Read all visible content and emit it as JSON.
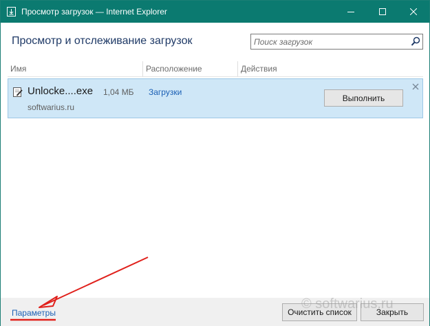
{
  "window": {
    "title": "Просмотр загрузок — Internet Explorer",
    "accent_color": "#0b7a70",
    "controls": [
      "minimize-icon",
      "maximize-icon",
      "close-icon"
    ]
  },
  "header": {
    "title": "Просмотр и отслеживание загрузок",
    "search_placeholder": "Поиск загрузок",
    "search_icon": "search-icon"
  },
  "table": {
    "columns": [
      "Имя",
      "Расположение",
      "Действия"
    ],
    "rows": [
      {
        "icon": "file-icon",
        "name": "Unlocke....exe",
        "size": "1,04 МБ",
        "source": "softwarius.ru",
        "location": "Загрузки",
        "action_label": "Выполнить",
        "dismiss_icon": "close-icon"
      }
    ]
  },
  "footer": {
    "settings_link": "Параметры",
    "clear_button": "Очистить список",
    "close_button": "Закрыть"
  },
  "watermark": "© softwarius.ru",
  "annotation_color": "#e0201b"
}
